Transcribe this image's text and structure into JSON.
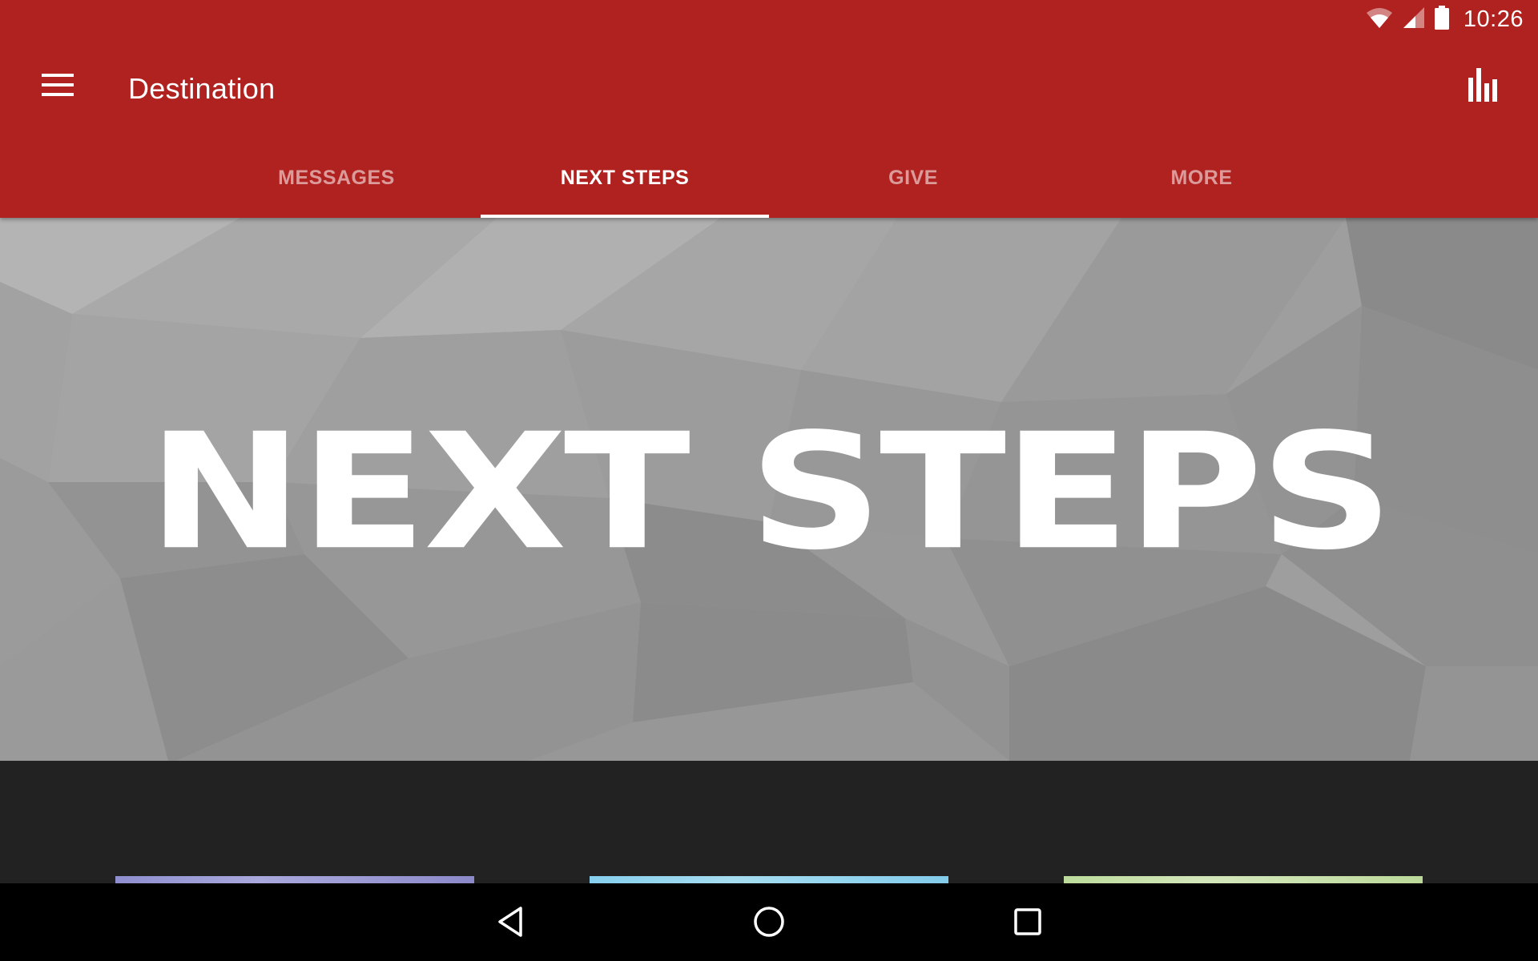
{
  "status_bar": {
    "time": "10:26",
    "icons": [
      "wifi-icon",
      "cell-signal-icon",
      "battery-icon"
    ]
  },
  "toolbar": {
    "menu_icon": "hamburger-menu-icon",
    "title": "Destination",
    "action_icon": "bar-chart-icon"
  },
  "tabs": [
    {
      "label": "MESSAGES",
      "active": false
    },
    {
      "label": "NEXT STEPS",
      "active": true
    },
    {
      "label": "GIVE",
      "active": false
    },
    {
      "label": "MORE",
      "active": false
    }
  ],
  "hero": {
    "title": "NEXT STEPS"
  },
  "cards": [
    {
      "name": "card-1",
      "accent": "#9c9ad4"
    },
    {
      "name": "card-2",
      "accent": "#94d5ef"
    },
    {
      "name": "card-3",
      "accent": "#c9e1ad"
    }
  ],
  "nav_bar": {
    "buttons": [
      "back-icon",
      "home-icon",
      "recents-icon"
    ]
  },
  "colors": {
    "primary": "#B02220",
    "tab_indicator": "#FFFFFF",
    "content_background": "#222222",
    "nav_background": "#000000"
  }
}
